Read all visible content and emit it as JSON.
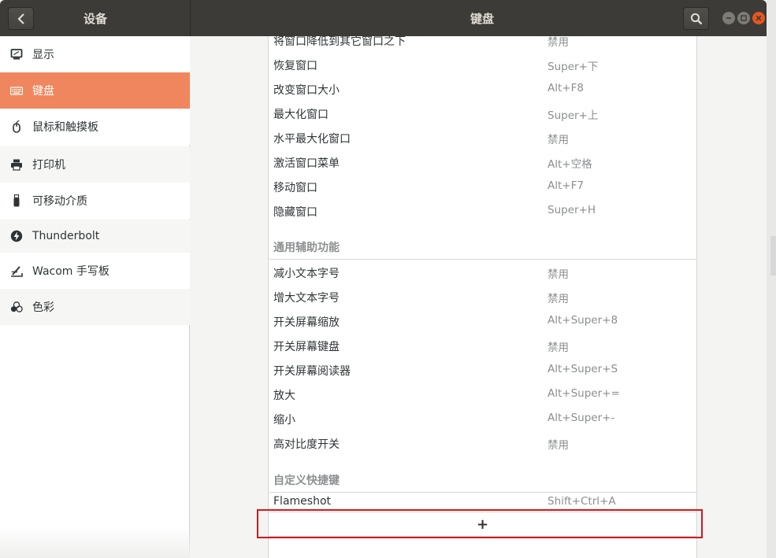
{
  "window": {
    "sidebar_title": "设备",
    "main_title": "键盘"
  },
  "sidebar": {
    "items": [
      {
        "label": "显示",
        "icon": "display-icon"
      },
      {
        "label": "键盘",
        "icon": "keyboard-icon",
        "selected": true
      },
      {
        "label": "鼠标和触摸板",
        "icon": "mouse-icon"
      },
      {
        "label": "打印机",
        "icon": "printer-icon"
      },
      {
        "label": "可移动介质",
        "icon": "usb-drive-icon"
      },
      {
        "label": "Thunderbolt",
        "icon": "thunderbolt-icon"
      },
      {
        "label": "Wacom 手写板",
        "icon": "tablet-icon"
      },
      {
        "label": "色彩",
        "icon": "color-icon"
      }
    ]
  },
  "shortcuts": {
    "windows_rows": [
      {
        "name": "将窗口降低到其它窗口之下",
        "key": "禁用"
      },
      {
        "name": "恢复窗口",
        "key": "Super+下"
      },
      {
        "name": "改变窗口大小",
        "key": "Alt+F8"
      },
      {
        "name": "最大化窗口",
        "key": "Super+上"
      },
      {
        "name": "水平最大化窗口",
        "key": "禁用"
      },
      {
        "name": "激活窗口菜单",
        "key": "Alt+空格"
      },
      {
        "name": "移动窗口",
        "key": "Alt+F7"
      },
      {
        "name": "隐藏窗口",
        "key": "Super+H"
      }
    ],
    "accessibility_title": "通用辅助功能",
    "accessibility_rows": [
      {
        "name": "减小文本字号",
        "key": "禁用"
      },
      {
        "name": "增大文本字号",
        "key": "禁用"
      },
      {
        "name": "开关屏幕缩放",
        "key": "Alt+Super+8"
      },
      {
        "name": "开关屏幕键盘",
        "key": "禁用"
      },
      {
        "name": "开关屏幕阅读器",
        "key": "Alt+Super+S"
      },
      {
        "name": "放大",
        "key": "Alt+Super+="
      },
      {
        "name": "缩小",
        "key": "Alt+Super+-"
      },
      {
        "name": "高对比度开关",
        "key": "禁用"
      }
    ],
    "custom_title": "自定义快捷键",
    "custom_rows": [
      {
        "name": "Flameshot",
        "key": "Shift+Ctrl+A"
      }
    ],
    "add_label": "+"
  },
  "colors": {
    "accent": "#f0865d",
    "header": "#3c3b37",
    "close": "#e6561e",
    "highlight": "#d7171a"
  }
}
